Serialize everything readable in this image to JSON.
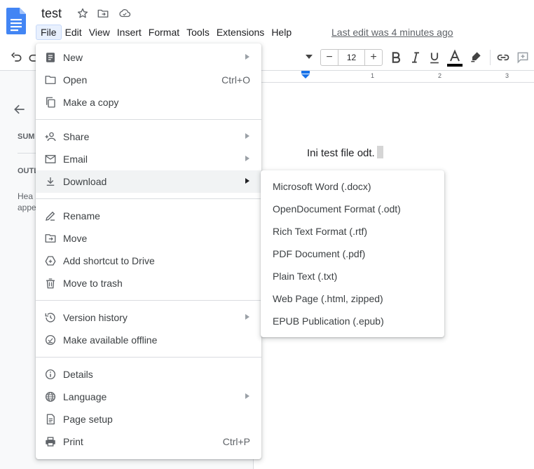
{
  "title": "test",
  "menubar": [
    "File",
    "Edit",
    "View",
    "Insert",
    "Format",
    "Tools",
    "Extensions",
    "Help"
  ],
  "last_edit": "Last edit was 4 minutes ago",
  "toolbar": {
    "font_size": "12",
    "minus": "−",
    "plus": "+"
  },
  "ruler": {
    "numbers": [
      "1",
      "2",
      "3"
    ]
  },
  "side_panel": {
    "summary": "SUM",
    "outline": "OUTL",
    "hint_line1": "Hea",
    "hint_line2": "appe"
  },
  "document": {
    "text": "Ini test file odt."
  },
  "file_menu": {
    "groups": [
      [
        {
          "label": "New",
          "icon": "new-doc-icon",
          "submenu": true
        },
        {
          "label": "Open",
          "icon": "folder-icon",
          "shortcut": "Ctrl+O"
        },
        {
          "label": "Make a copy",
          "icon": "copy-icon"
        }
      ],
      [
        {
          "label": "Share",
          "icon": "person-add-icon",
          "submenu": true
        },
        {
          "label": "Email",
          "icon": "email-icon",
          "submenu": true
        },
        {
          "label": "Download",
          "icon": "download-icon",
          "submenu": true,
          "highlighted": true
        }
      ],
      [
        {
          "label": "Rename",
          "icon": "rename-icon"
        },
        {
          "label": "Move",
          "icon": "move-icon"
        },
        {
          "label": "Add shortcut to Drive",
          "icon": "add-shortcut-icon"
        },
        {
          "label": "Move to trash",
          "icon": "trash-icon"
        }
      ],
      [
        {
          "label": "Version history",
          "icon": "history-icon",
          "submenu": true
        },
        {
          "label": "Make available offline",
          "icon": "offline-icon"
        }
      ],
      [
        {
          "label": "Details",
          "icon": "info-icon"
        },
        {
          "label": "Language",
          "icon": "globe-icon",
          "submenu": true
        },
        {
          "label": "Page setup",
          "icon": "page-setup-icon"
        },
        {
          "label": "Print",
          "icon": "print-icon",
          "shortcut": "Ctrl+P"
        }
      ]
    ]
  },
  "download_menu": [
    "Microsoft Word (.docx)",
    "OpenDocument Format (.odt)",
    "Rich Text Format (.rtf)",
    "PDF Document (.pdf)",
    "Plain Text (.txt)",
    "Web Page (.html, zipped)",
    "EPUB Publication (.epub)"
  ],
  "colors": {
    "docs_blue": "#4285f4",
    "menu_highlight": "#f1f3f4",
    "active_menu": "#e8f0fe"
  }
}
